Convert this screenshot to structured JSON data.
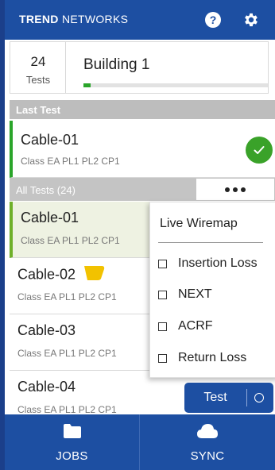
{
  "header": {
    "brand_bold": "TREND",
    "brand_light": "NETWORKS",
    "icons": [
      "help-icon",
      "gear-icon"
    ],
    "color": "#1d4fa2"
  },
  "summary": {
    "test_count": "24",
    "test_count_label": "Tests",
    "building_name": "Building 1",
    "progress_fraction": 0.04,
    "progress_color": "#2aa52a"
  },
  "last_test": {
    "section_label": "Last Test",
    "cable_name": "Cable-01",
    "cable_class": "Class EA PL1 PL2 CP1",
    "status_icon": "check-icon",
    "status_color": "#3aa229"
  },
  "all_tests": {
    "label": "All Tests (24)",
    "more_icon": "more-dots-icon"
  },
  "rows": [
    {
      "name": "Cable-01",
      "cls": "Class EA PL1 PL2 CP1"
    },
    {
      "name": "Cable-02",
      "cls": "Class EA PL1 PL2 CP1",
      "tag_color": "#f2c200"
    },
    {
      "name": "Cable-03",
      "cls": "Class EA PL1 PL2 CP1"
    },
    {
      "name": "Cable-04",
      "cls": "Class EA PL1 PL2 CP1"
    }
  ],
  "menu": {
    "header": "Live Wiremap",
    "items": [
      "Insertion Loss",
      "NEXT",
      "ACRF",
      "Return Loss"
    ]
  },
  "test_button": {
    "label": "Test",
    "icon": "loop-icon"
  },
  "bottom_nav": {
    "jobs_label": "JOBS",
    "jobs_icon": "folder-icon",
    "sync_label": "SYNC",
    "sync_icon": "cloud-icon"
  }
}
